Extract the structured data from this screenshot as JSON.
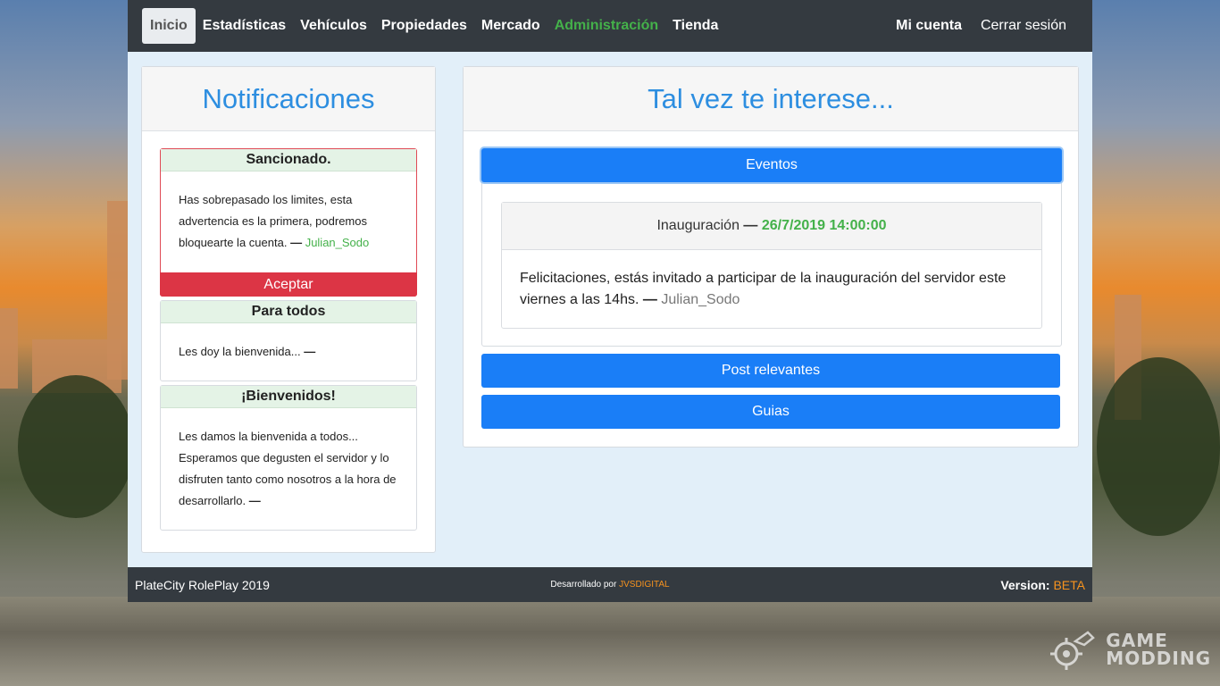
{
  "nav": {
    "items": [
      "Inicio",
      "Estadísticas",
      "Vehículos",
      "Propiedades",
      "Mercado",
      "Administración",
      "Tienda"
    ],
    "account": "Mi cuenta",
    "logout": "Cerrar sesión"
  },
  "notifications": {
    "title": "Notificaciones",
    "items": [
      {
        "title": "Sancionado.",
        "body": "Has sobrepasado los limites, esta advertencia es la primera, podremos bloquearte la cuenta.",
        "dash": "—",
        "author": "Julian_Sodo",
        "button": "Aceptar"
      },
      {
        "title": "Para todos",
        "body": "Les doy la bienvenida...",
        "dash": "—",
        "author": ""
      },
      {
        "title": "¡Bienvenidos!",
        "body": "Les damos la bienvenida a todos... Esperamos que degusten el servidor y lo disfruten tanto como nosotros a la hora de desarrollarlo.",
        "dash": "—",
        "author": ""
      }
    ]
  },
  "interest": {
    "title": "Tal vez te interese...",
    "events_label": "Eventos",
    "event": {
      "name": "Inauguración",
      "dash": "—",
      "date": "26/7/2019 14:00:00",
      "body": "Felicitaciones, estás invitado a participar de la inauguración del servidor este viernes a las 14hs.",
      "author_dash": "—",
      "author": "Julian_Sodo"
    },
    "posts_label": "Post relevantes",
    "guides_label": "Guias"
  },
  "footer": {
    "left": "PlateCity RolePlay 2019",
    "dev_prefix": "Desarrollado por",
    "dev_name": "JVSDIGITAL",
    "version_label": "Version:",
    "version_value": "BETA"
  },
  "watermark": {
    "line1": "GAME",
    "line2": "MODDING",
    "logo_icon": "gear-robot-icon"
  },
  "colors": {
    "accent_blue": "#1a7ef7",
    "title_blue": "#2d8ee0",
    "admin_green": "#44b14a",
    "danger_red": "#dc3545",
    "nav_dark": "#343a40",
    "footer_orange": "#f7931e"
  }
}
